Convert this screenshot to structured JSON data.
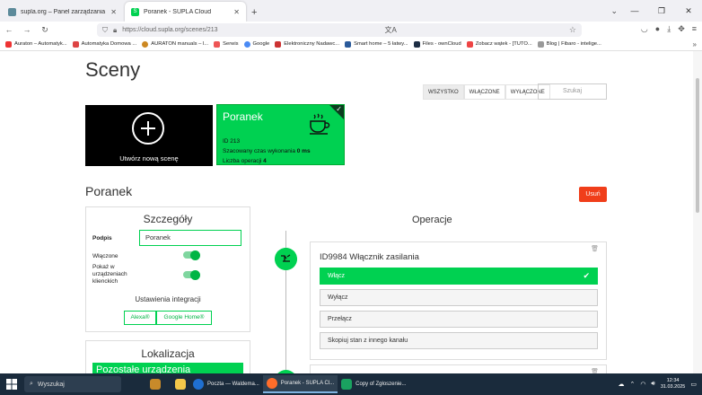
{
  "browser": {
    "tabs": [
      {
        "title": "supla.org – Panel zarządzania konte",
        "active": false
      },
      {
        "title": "Poranek - SUPLA Cloud",
        "active": true
      }
    ],
    "new_tab": "+",
    "url": "https://cloud.supla.org/scenes/213",
    "bookmarks": [
      "Auraton – Automatyk...",
      "Automatyka Domowa ...",
      "AURATON manuals – l...",
      "Serwis",
      "Google",
      "Elektroniczny Nadawc...",
      "Smart home – 5 łatwy...",
      "Files - ownCloud",
      "Zobacz wątek - [TUTO...",
      "Blog | Fibaro - intelige..."
    ]
  },
  "page": {
    "title": "Sceny",
    "filters": [
      "WSZYSTKO",
      "WŁĄCZONE",
      "WYŁĄCZONE"
    ],
    "search_placeholder": "Szukaj",
    "new_scene_label": "Utwórz nową scenę",
    "scene_tile": {
      "name": "Poranek",
      "id_line": "ID 213",
      "duration_label": "Szacowany czas wykonania",
      "duration_value": "0 ms",
      "ops_label": "Liczba operacji",
      "ops_value": "4"
    },
    "section_title": "Poranek",
    "delete_label": "Usuń",
    "details": {
      "title": "Szczegóły",
      "caption_label": "Podpis",
      "caption_value": "Poranek",
      "enabled_label": "Włączone",
      "show_clients_label": "Pokaż w urządzeniach klienckich",
      "integrations_title": "Ustawienia integracji",
      "alexa": "Alexa®",
      "google_home": "Google Home®"
    },
    "location": {
      "title": "Lokalizacja",
      "value": "Pozostałe urządzenia"
    },
    "operations": {
      "title": "Operacje",
      "items": [
        {
          "name": "ID9984 Włącznik zasilania",
          "options": [
            "Włącz",
            "Wyłącz",
            "Przełącz",
            "Skopiuj stan z innego kanału"
          ],
          "selected": 0
        }
      ]
    }
  },
  "taskbar": {
    "search": "Wyszukaj",
    "apps": [
      "Poczta — Waldema...",
      "Poranek - SUPLA Cl...",
      "Copy of Zgłoszenie..."
    ],
    "time": "12:34",
    "date": "31.03.2025"
  },
  "colors": {
    "supla_green": "#00d151",
    "delete_red": "#f03e1a"
  }
}
